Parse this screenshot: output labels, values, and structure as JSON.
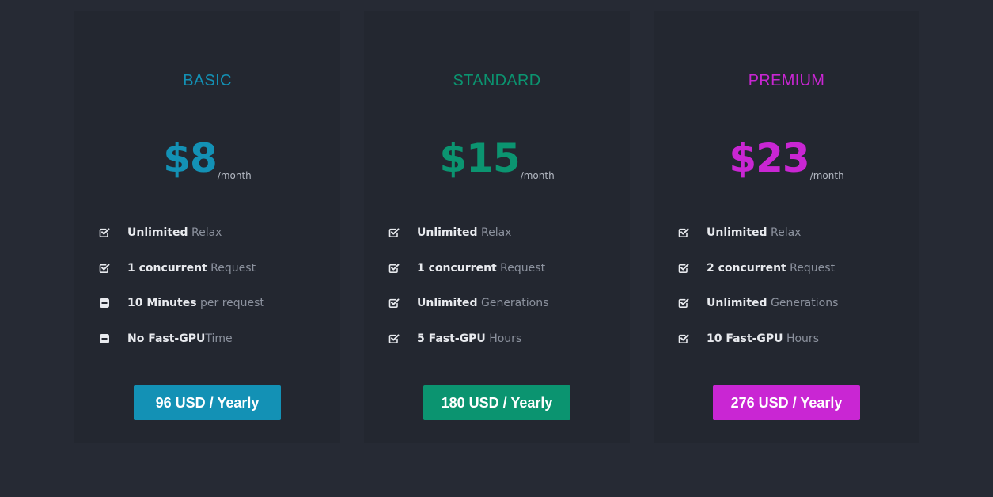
{
  "plans": [
    {
      "name": "BASIC",
      "price": "$8",
      "period": "/month",
      "accent": "#1391b5",
      "features": [
        {
          "icon": "checkbox-checked-icon",
          "strong": "Unlimited",
          "light": " Relax"
        },
        {
          "icon": "checkbox-checked-icon",
          "strong": "1 concurrent",
          "light": " Request"
        },
        {
          "icon": "minus-square-icon",
          "strong": "10 Minutes",
          "light": " per request"
        },
        {
          "icon": "minus-square-icon",
          "strong": "No Fast-GPU",
          "light": "Time"
        }
      ],
      "cta": "96 USD / Yearly"
    },
    {
      "name": "STANDARD",
      "price": "$15",
      "period": "/month",
      "accent": "#0b9470",
      "features": [
        {
          "icon": "checkbox-checked-icon",
          "strong": "Unlimited",
          "light": " Relax"
        },
        {
          "icon": "checkbox-checked-icon",
          "strong": "1 concurrent",
          "light": " Request"
        },
        {
          "icon": "checkbox-checked-icon",
          "strong": "Unlimited",
          "light": " Generations"
        },
        {
          "icon": "checkbox-checked-icon",
          "strong": "5 Fast-GPU",
          "light": " Hours"
        }
      ],
      "cta": "180 USD / Yearly"
    },
    {
      "name": "PREMIUM",
      "price": "$23",
      "period": "/month",
      "accent": "#c926d3",
      "features": [
        {
          "icon": "checkbox-checked-icon",
          "strong": "Unlimited",
          "light": " Relax"
        },
        {
          "icon": "checkbox-checked-icon",
          "strong": "2 concurrent",
          "light": " Request"
        },
        {
          "icon": "checkbox-checked-icon",
          "strong": "Unlimited",
          "light": " Generations"
        },
        {
          "icon": "checkbox-checked-icon",
          "strong": "10 Fast-GPU",
          "light": " Hours"
        }
      ],
      "cta": "276 USD / Yearly"
    }
  ]
}
